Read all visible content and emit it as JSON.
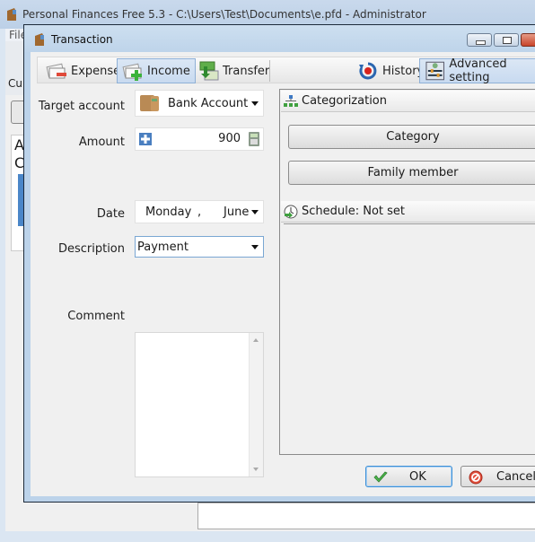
{
  "app": {
    "title": "Personal Finances Free 5.3 - C:\\Users\\Test\\Documents\\e.pfd - Administrator",
    "menu_file": "File",
    "ribbon_partial_label": "Cur",
    "side_partial_a": "A",
    "side_partial_c": "C"
  },
  "dialog": {
    "title": "Transaction",
    "toolbar": {
      "expense": "Expense",
      "income": "Income",
      "transfer": "Transfer",
      "history": "History",
      "advanced": "Advanced setting",
      "active_tab": "income"
    },
    "form": {
      "target_account_label": "Target account",
      "target_account_value": "Bank Account",
      "amount_label": "Amount",
      "amount_value": "900",
      "date_label": "Date",
      "date_day": "Monday",
      "date_sep": ",",
      "date_month": "June",
      "description_label": "Description",
      "description_value": "Payment",
      "comment_label": "Comment",
      "comment_value": ""
    },
    "categorization": {
      "title": "Categorization",
      "category": "Category",
      "family_member": "Family member"
    },
    "schedule": {
      "label": "Schedule: Not set"
    },
    "buttons": {
      "ok": "OK",
      "cancel": "Cancel"
    }
  },
  "colors": {
    "accent": "#3c8fd6",
    "titlebar": "#bcd3ea",
    "close": "#c8442a"
  }
}
